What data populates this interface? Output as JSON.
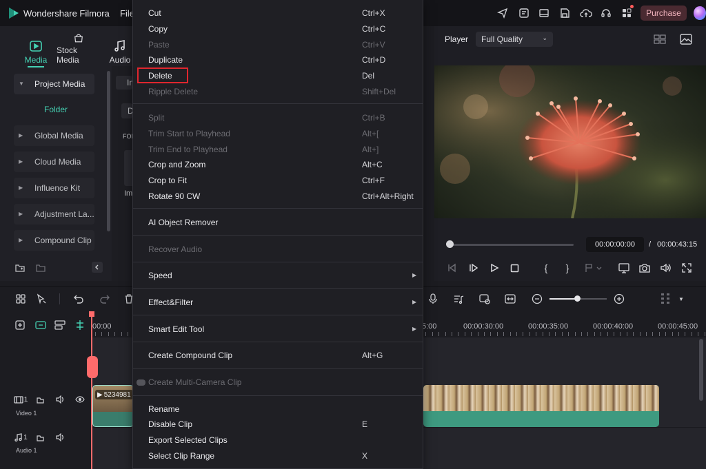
{
  "app": {
    "name": "Wondershare Filmora",
    "menu_file": "File",
    "purchase_label": "Purchase"
  },
  "colors": {
    "accent": "#45d2b4",
    "playhead": "#ff6b6b",
    "delete_highlight": "#e0262e",
    "purchase_bg": "#4a2a31"
  },
  "media_tabs": [
    {
      "label": "Media",
      "icon": "media-icon",
      "active": true
    },
    {
      "label": "Stock Media",
      "icon": "stock-media-icon"
    },
    {
      "label": "Audio",
      "icon": "audio-note-icon"
    }
  ],
  "sidebar": {
    "items": [
      {
        "label": "Project Media"
      },
      {
        "label": "Folder"
      },
      {
        "label": "Global Media"
      },
      {
        "label": "Cloud Media"
      },
      {
        "label": "Influence Kit"
      },
      {
        "label": "Adjustment La..."
      },
      {
        "label": "Compound Clip"
      }
    ]
  },
  "mid_stub": {
    "a": "In",
    "b": "D",
    "c": "FOL",
    "d": "Im"
  },
  "player": {
    "label": "Player",
    "quality": "Full Quality",
    "current_time": "00:00:00:00",
    "separator": "/",
    "total_time": "00:00:43:15"
  },
  "ruler": {
    "labels": [
      "00:00",
      "5:00",
      "00:00:30:00",
      "00:00:35:00",
      "00:00:40:00",
      "00:00:45:00"
    ]
  },
  "tracks": {
    "video_label": "Video 1",
    "video_index": "1",
    "audio_label": "Audio 1",
    "audio_index": "1",
    "clip_name": "5234981"
  },
  "context_menu": {
    "items": [
      {
        "label": "Cut",
        "shortcut": "Ctrl+X"
      },
      {
        "label": "Copy",
        "shortcut": "Ctrl+C"
      },
      {
        "label": "Paste",
        "shortcut": "Ctrl+V",
        "disabled": true
      },
      {
        "label": "Duplicate",
        "shortcut": "Ctrl+D"
      },
      {
        "label": "Delete",
        "shortcut": "Del",
        "highlighted": true
      },
      {
        "label": "Ripple Delete",
        "shortcut": "Shift+Del",
        "disabled": true
      },
      {
        "label": "Split",
        "shortcut": "Ctrl+B",
        "disabled": true
      },
      {
        "label": "Trim Start to Playhead",
        "shortcut": "Alt+[",
        "disabled": true
      },
      {
        "label": "Trim End to Playhead",
        "shortcut": "Alt+]",
        "disabled": true
      },
      {
        "label": "Crop and Zoom",
        "shortcut": "Alt+C"
      },
      {
        "label": "Crop to Fit",
        "shortcut": "Ctrl+F"
      },
      {
        "label": "Rotate 90 CW",
        "shortcut": "Ctrl+Alt+Right"
      },
      {
        "label": "AI Object Remover",
        "shortcut": ""
      },
      {
        "label": "Recover Audio",
        "shortcut": "",
        "disabled": true
      },
      {
        "label": "Speed",
        "shortcut": "",
        "submenu": true
      },
      {
        "label": "Effect&Filter",
        "shortcut": "",
        "submenu": true
      },
      {
        "label": "Smart Edit Tool",
        "shortcut": "",
        "submenu": true
      },
      {
        "label": "Create Compound Clip",
        "shortcut": "Alt+G"
      },
      {
        "label": "Create Multi-Camera Clip",
        "shortcut": "",
        "disabled": true
      },
      {
        "label": "Rename",
        "shortcut": ""
      },
      {
        "label": "Disable Clip",
        "shortcut": "E"
      },
      {
        "label": "Export Selected Clips",
        "shortcut": ""
      },
      {
        "label": "Select Clip Range",
        "shortcut": "X"
      }
    ]
  }
}
